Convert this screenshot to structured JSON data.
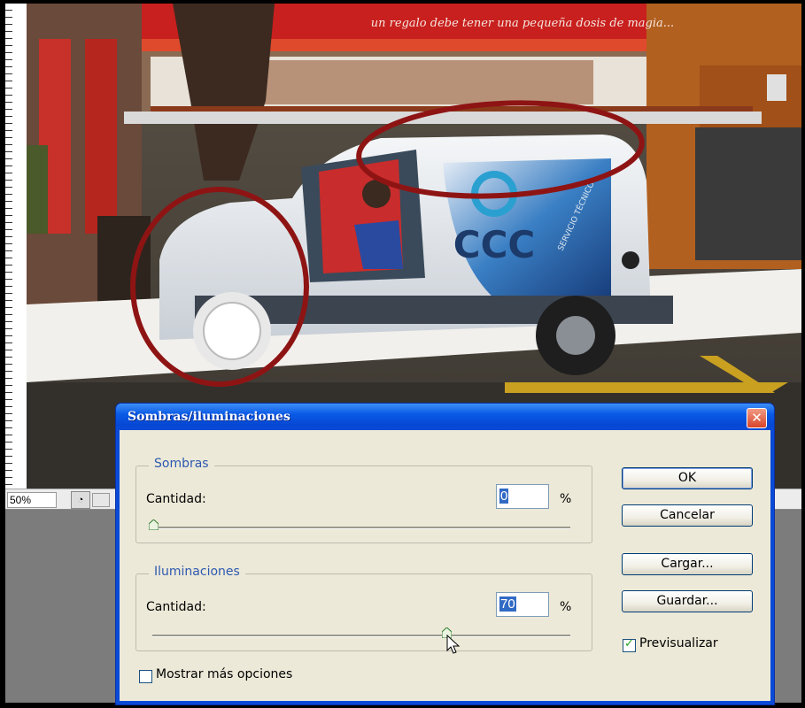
{
  "status_bar": {
    "zoom": "50%"
  },
  "dialog": {
    "title": "Sombras/iluminaciones",
    "close_glyph": "✕",
    "shadows": {
      "legend": "Sombras",
      "label": "Cantidad:",
      "value": "0",
      "unit": "%",
      "slider_level": 0
    },
    "highlights": {
      "legend": "Iluminaciones",
      "label": "Cantidad:",
      "value": "70",
      "unit": "%",
      "slider_level": 70
    },
    "buttons": {
      "ok": "OK",
      "cancel": "Cancelar",
      "load": "Cargar...",
      "save": "Guardar..."
    },
    "preview": {
      "label": "Previsualizar",
      "checked": true
    },
    "more_options": {
      "label": "Mostrar más opciones",
      "checked": false
    }
  },
  "photo": {
    "storefront_banner": "un regalo debe tener una pequeña dosis de magia...",
    "van_logo": "CCC",
    "van_side_text": "SERVICIO TÉCNICO"
  },
  "colors": {
    "xp_title_blue": "#0a4ad6",
    "dialog_face": "#ece9d8",
    "annotation_ring": "#9b1a1a",
    "store_red": "#c8201e"
  }
}
